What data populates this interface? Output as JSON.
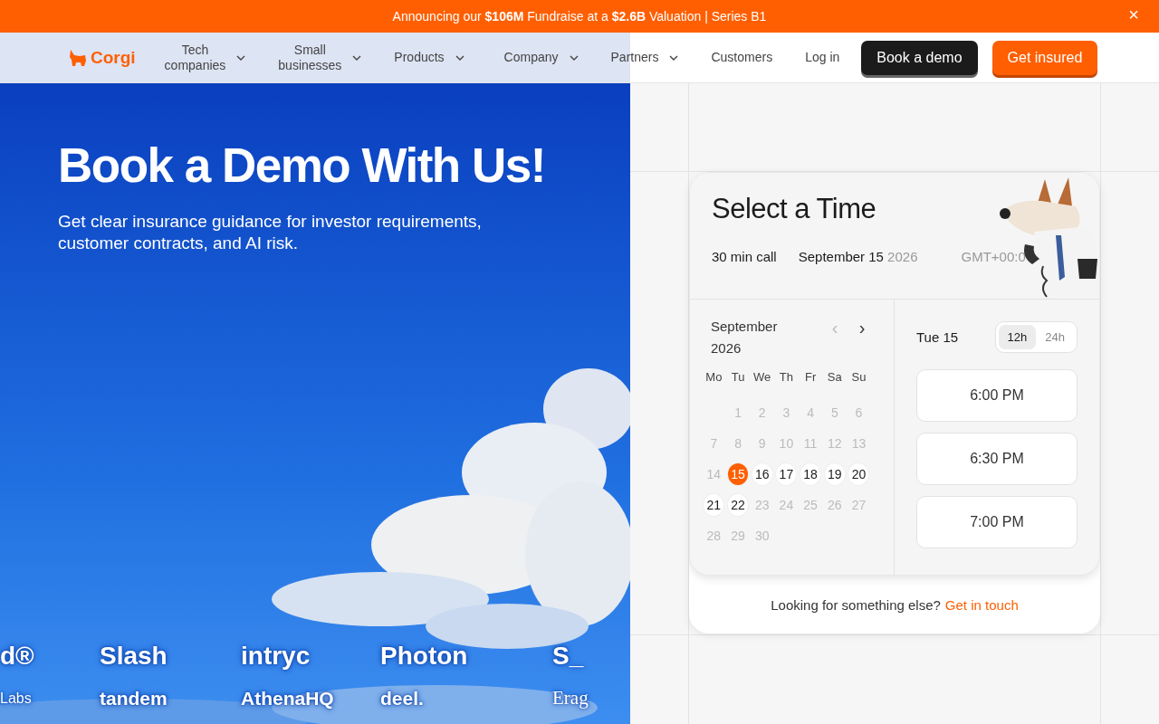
{
  "banner": {
    "text": "Announcing our **$106M** Fundraise at a **$2.6B** Valuation | Series B1",
    "close": "×"
  },
  "nav": {
    "logo": "Corgi",
    "items": [
      {
        "label": "Tech\ncompanies",
        "dropdown": true
      },
      {
        "label": "Small\nbusinesses",
        "dropdown": true
      },
      {
        "label": "Products",
        "dropdown": true
      },
      {
        "label": "Company",
        "dropdown": true
      },
      {
        "label": "Partners",
        "dropdown": true
      },
      {
        "label": "Customers",
        "dropdown": false
      }
    ],
    "login": "Log in",
    "demo_button": "Book a demo",
    "insure_button": "Get insured"
  },
  "hero": {
    "title": "Book a Demo With Us!",
    "subtitle": "Get clear insurance guidance for investor requirements, customer contracts, and AI risk.",
    "logo_rows": [
      [
        "d®",
        "Slash",
        "intryc",
        "Photon",
        "S_"
      ],
      [
        "Labs",
        "tandem",
        "AthenaHQ",
        "deel.",
        "Erag"
      ]
    ]
  },
  "booking": {
    "title": "Select a Time",
    "duration": "30 min call",
    "date": "September 15",
    "year": "2026",
    "timezone": "GMT+00:0",
    "month": "September",
    "month_year": "2026",
    "prev": "‹",
    "next": "›",
    "weekdays": [
      "Mo",
      "Tu",
      "We",
      "Th",
      "Fr",
      "Sa",
      "Su"
    ],
    "weeks": [
      [
        {
          "day": "1",
          "available": false,
          "selected": false
        },
        {
          "day": "2",
          "available": false,
          "selected": false
        },
        {
          "day": "3",
          "available": false,
          "selected": false
        },
        {
          "day": "4",
          "available": false,
          "selected": false
        },
        {
          "day": "5",
          "available": false,
          "selected": false
        },
        {
          "day": "6",
          "available": false,
          "selected": false
        }
      ],
      [
        {
          "day": "7",
          "available": false,
          "selected": false
        },
        {
          "day": "8",
          "available": false,
          "selected": false
        },
        {
          "day": "9",
          "available": false,
          "selected": false
        },
        {
          "day": "10",
          "available": false,
          "selected": false
        },
        {
          "day": "11",
          "available": false,
          "selected": false
        },
        {
          "day": "12",
          "available": false,
          "selected": false
        },
        {
          "day": "13",
          "available": false,
          "selected": false
        }
      ],
      [
        {
          "day": "14",
          "available": false,
          "selected": false
        },
        {
          "day": "15",
          "available": true,
          "selected": true
        },
        {
          "day": "16",
          "available": true,
          "selected": false
        },
        {
          "day": "17",
          "available": true,
          "selected": false
        },
        {
          "day": "18",
          "available": true,
          "selected": false
        },
        {
          "day": "19",
          "available": true,
          "selected": false
        },
        {
          "day": "20",
          "available": true,
          "selected": false
        }
      ],
      [
        {
          "day": "21",
          "available": true,
          "selected": false
        },
        {
          "day": "22",
          "available": true,
          "selected": false
        },
        {
          "day": "23",
          "available": false,
          "selected": false
        },
        {
          "day": "24",
          "available": false,
          "selected": false
        },
        {
          "day": "25",
          "available": false,
          "selected": false
        },
        {
          "day": "26",
          "available": false,
          "selected": false
        },
        {
          "day": "27",
          "available": false,
          "selected": false
        }
      ],
      [
        {
          "day": "28",
          "available": false,
          "selected": false
        },
        {
          "day": "29",
          "available": false,
          "selected": false
        },
        {
          "day": "30",
          "available": false,
          "selected": false
        }
      ]
    ],
    "day_label": "Tue 15",
    "formats": [
      {
        "label": "12h",
        "selected": true
      },
      {
        "label": "24h",
        "selected": false
      }
    ],
    "slots": [
      "6:00 PM",
      "6:30 PM",
      "7:00 PM"
    ],
    "footer_text": "Looking for something else?",
    "footer_link": "Get in touch"
  }
}
